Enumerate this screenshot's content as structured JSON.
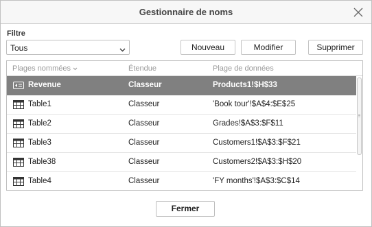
{
  "dialog": {
    "title": "Gestionnaire de noms",
    "close_icon": "close-icon"
  },
  "filter": {
    "label": "Filtre",
    "value": "Tous",
    "icon": "chevron-down-icon"
  },
  "buttons": {
    "new": "Nouveau",
    "edit": "Modifier",
    "delete": "Supprimer",
    "close": "Fermer"
  },
  "table": {
    "columns": {
      "name": "Plages nommées",
      "scope": "Étendue",
      "range": "Plage de données"
    },
    "rows": [
      {
        "icon": "named-range-icon",
        "name": "Revenue",
        "scope": "Classeur",
        "range": "Products1!$H$33",
        "selected": true
      },
      {
        "icon": "table-icon",
        "name": "Table1",
        "scope": "Classeur",
        "range": "'Book tour'!$A$4:$E$25",
        "selected": false
      },
      {
        "icon": "table-icon",
        "name": "Table2",
        "scope": "Classeur",
        "range": "Grades!$A$3:$F$11",
        "selected": false
      },
      {
        "icon": "table-icon",
        "name": "Table3",
        "scope": "Classeur",
        "range": "Customers1!$A$3:$F$21",
        "selected": false
      },
      {
        "icon": "table-icon",
        "name": "Table38",
        "scope": "Classeur",
        "range": "Customers2!$A$3:$H$20",
        "selected": false
      },
      {
        "icon": "table-icon",
        "name": "Table4",
        "scope": "Classeur",
        "range": "'FY months'!$A$3:$C$14",
        "selected": false
      }
    ]
  },
  "colors": {
    "selected_row": "#808080",
    "header_text": "#9a9a9a",
    "border": "#bfbfbf"
  }
}
